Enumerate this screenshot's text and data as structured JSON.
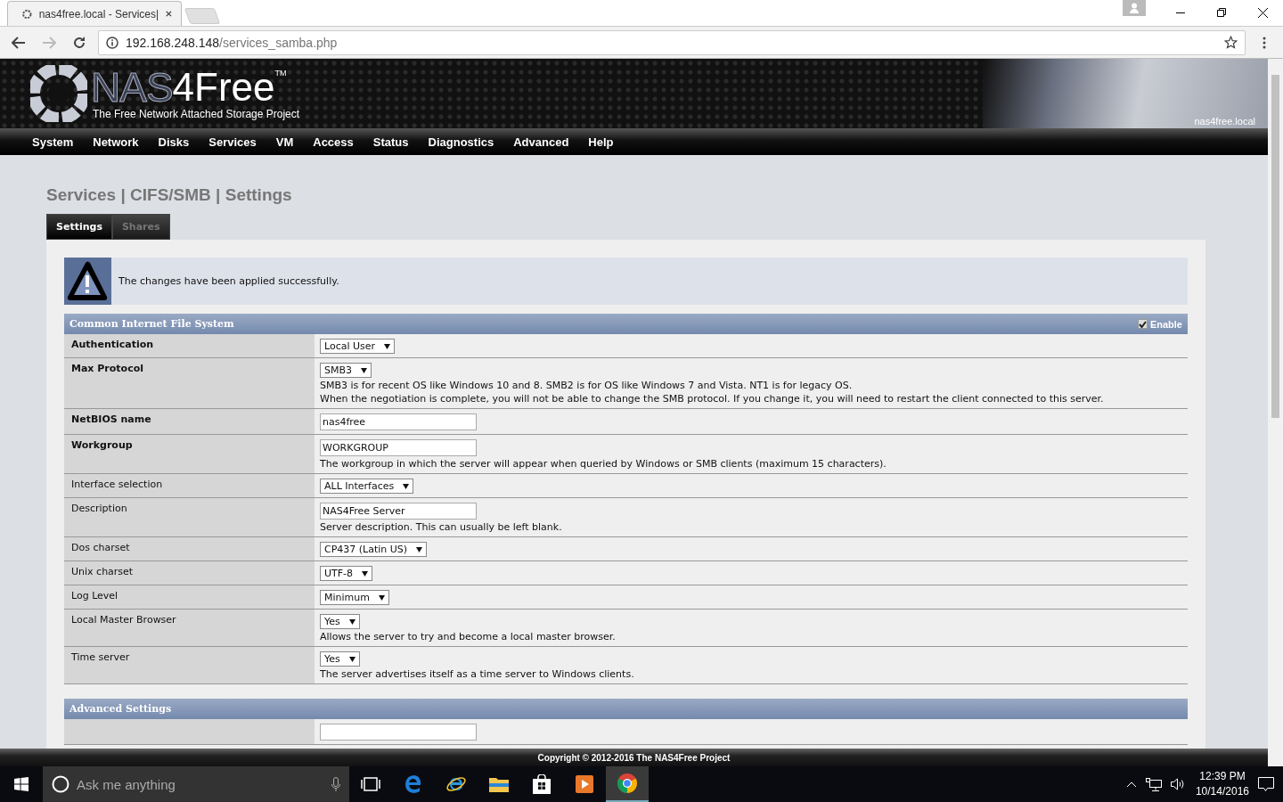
{
  "browser": {
    "tabs": [
      {
        "title": "nas4free.local - Services|",
        "selected": true
      }
    ],
    "address": {
      "host": "192.168.248.148",
      "path": "/services_samba.php"
    }
  },
  "header": {
    "logo_main": "NAS",
    "logo_accent": "4Free",
    "trademark": "TM",
    "tagline": "The Free Network Attached Storage Project",
    "hostname": "nas4free.local"
  },
  "nav": [
    "System",
    "Network",
    "Disks",
    "Services",
    "VM",
    "Access",
    "Status",
    "Diagnostics",
    "Advanced",
    "Help"
  ],
  "page_title": "Services | CIFS/SMB | Settings",
  "tabs": [
    {
      "label": "Settings",
      "selected": true
    },
    {
      "label": "Shares",
      "selected": false
    }
  ],
  "notice": "The changes have been applied successfully.",
  "sections": [
    {
      "title": "Common Internet File System",
      "enable": {
        "label": "Enable",
        "checked": true
      },
      "rows": [
        {
          "label": "Authentication",
          "required": true,
          "kind": "select",
          "value": "Local User"
        },
        {
          "label": "Max Protocol",
          "required": true,
          "kind": "select",
          "value": "SMB3",
          "description": [
            "SMB3 is for recent OS like Windows 10 and 8. SMB2 is for OS like Windows 7 and Vista. NT1 is for legacy OS.",
            "When the negotiation is complete, you will not be able to change the SMB protocol. If you change it, you will need to restart the client connected to this server."
          ]
        },
        {
          "label": "NetBIOS name",
          "required": true,
          "kind": "text",
          "value": "nas4free"
        },
        {
          "label": "Workgroup",
          "required": true,
          "kind": "text",
          "value": "WORKGROUP",
          "description": [
            "The workgroup in which the server will appear when queried by Windows or SMB clients (maximum 15 characters)."
          ]
        },
        {
          "label": "Interface selection",
          "required": false,
          "kind": "select",
          "value": "ALL Interfaces"
        },
        {
          "label": "Description",
          "required": false,
          "kind": "text",
          "value": "NAS4Free Server",
          "description": [
            "Server description. This can usually be left blank."
          ]
        },
        {
          "label": "Dos charset",
          "required": false,
          "kind": "select",
          "value": "CP437 (Latin US)"
        },
        {
          "label": "Unix charset",
          "required": false,
          "kind": "select",
          "value": "UTF-8"
        },
        {
          "label": "Log Level",
          "required": false,
          "kind": "select",
          "value": "Minimum"
        },
        {
          "label": "Local Master Browser",
          "required": false,
          "kind": "select",
          "value": "Yes",
          "description": [
            "Allows the server to try and become a local master browser."
          ]
        },
        {
          "label": "Time server",
          "required": false,
          "kind": "select",
          "value": "Yes",
          "description": [
            "The server advertises itself as a time server to Windows clients."
          ]
        }
      ]
    },
    {
      "title": "Advanced Settings"
    }
  ],
  "footer": "Copyright © 2012-2016 The NAS4Free Project",
  "taskbar": {
    "search_placeholder": "Ask me anything",
    "time": "12:39 PM",
    "date": "10/14/2016"
  }
}
